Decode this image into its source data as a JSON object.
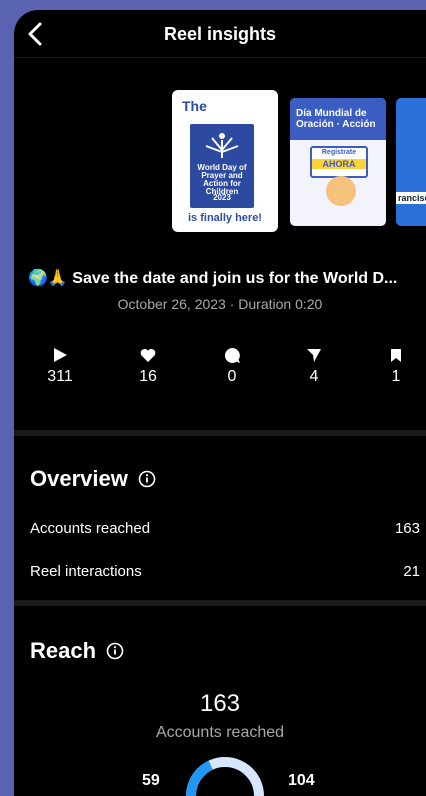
{
  "header": {
    "title": "Reel insights"
  },
  "thumbnails": {
    "t1_the": "The",
    "t1_box_text": "World Day of Prayer and Action for Children",
    "t1_year": "2023",
    "t1_footer": "is finally here!",
    "t2_title": "Día Mundial de Oración · Acción",
    "t2_badge_top": "Regístrate",
    "t2_badge": "AHORA",
    "t3_label": "rancisc"
  },
  "reel": {
    "caption": "🌍🙏 Save the date and join us for the World D...",
    "meta": "October 26, 2023 · Duration 0:20"
  },
  "stats": [
    {
      "icon": "play-icon",
      "value": "311"
    },
    {
      "icon": "heart-icon",
      "value": "16"
    },
    {
      "icon": "comment-icon",
      "value": "0"
    },
    {
      "icon": "share-icon",
      "value": "4"
    },
    {
      "icon": "bookmark-icon",
      "value": "1"
    }
  ],
  "overview": {
    "title": "Overview",
    "rows": [
      {
        "label": "Accounts reached",
        "value": "163"
      },
      {
        "label": "Reel interactions",
        "value": "21"
      }
    ]
  },
  "reach": {
    "title": "Reach",
    "total": "163",
    "label": "Accounts reached",
    "followers": "59",
    "non_followers": "104",
    "donut_colors": [
      "#2196f3",
      "#d6e6ff"
    ]
  }
}
